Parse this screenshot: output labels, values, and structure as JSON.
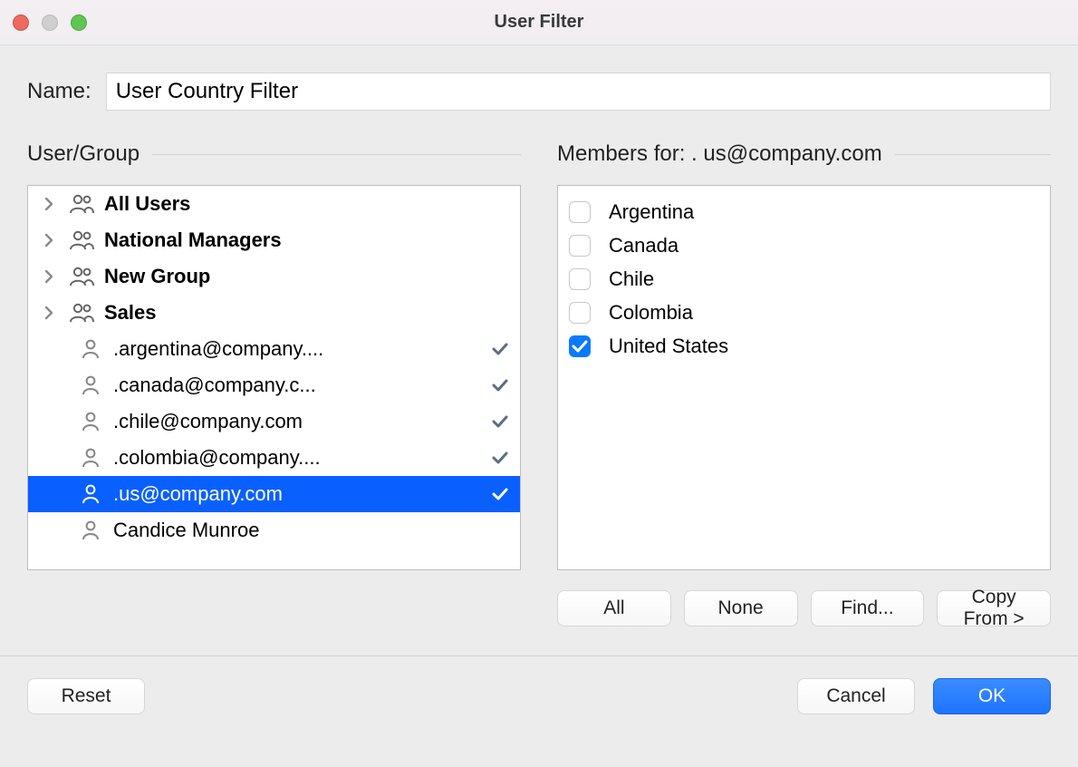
{
  "window": {
    "title": "User Filter"
  },
  "name": {
    "label": "Name:",
    "value": "User Country Filter"
  },
  "left": {
    "title": "User/Group",
    "rows": [
      {
        "type": "group",
        "label": "All Users"
      },
      {
        "type": "group",
        "label": "National Managers"
      },
      {
        "type": "group",
        "label": "New Group"
      },
      {
        "type": "group",
        "label": "Sales"
      },
      {
        "type": "user",
        "label": ".argentina@company....",
        "check": true
      },
      {
        "type": "user",
        "label": ".canada@company.c...",
        "check": true
      },
      {
        "type": "user",
        "label": ".chile@company.com",
        "check": true
      },
      {
        "type": "user",
        "label": ".colombia@company....",
        "check": true
      },
      {
        "type": "user",
        "label": ".us@company.com",
        "check": true,
        "selected": true
      },
      {
        "type": "user",
        "label": "Candice Munroe",
        "check": false
      }
    ]
  },
  "right": {
    "title_prefix": "Members for: ",
    "title_subject": ". us@company.com",
    "members": [
      {
        "label": "Argentina",
        "checked": false
      },
      {
        "label": "Canada",
        "checked": false
      },
      {
        "label": "Chile",
        "checked": false
      },
      {
        "label": "Colombia",
        "checked": false
      },
      {
        "label": "United States",
        "checked": true
      }
    ],
    "actions": {
      "all": "All",
      "none": "None",
      "find": "Find...",
      "copy": "Copy From >"
    }
  },
  "footer": {
    "reset": "Reset",
    "cancel": "Cancel",
    "ok": "OK"
  }
}
